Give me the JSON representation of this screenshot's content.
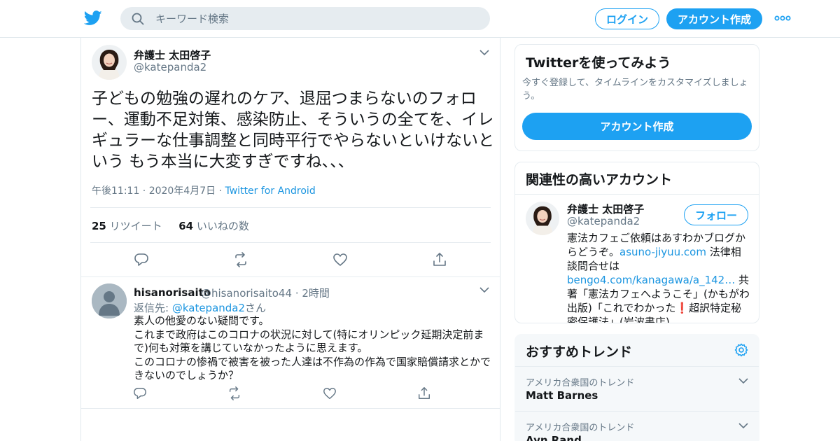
{
  "header": {
    "search_placeholder": "キーワード検索",
    "login_label": "ログイン",
    "signup_label": "アカウント作成",
    "brand_color": "#1da1f2"
  },
  "tweet": {
    "author_name": "弁護士 太田啓子",
    "author_handle": "@katepanda2",
    "text": "子どもの勉強の遅れのケア、退屈つまらないのフォロー、運動不足対策、感染防止、そういうの全てを、イレギュラーな仕事調整と同時平行でやらないといけないという もう本当に大変すぎですね、、、",
    "time": "午後11:11 · 2020年4月7日 · ",
    "source": "Twitter for Android",
    "retweet_count": "25",
    "retweet_label": "リツイート",
    "like_count": "64",
    "like_label": "いいねの数"
  },
  "reply": {
    "author_name": "hisanorisaito",
    "author_handle": "@hisanorisaito44",
    "time": "· 2時間",
    "reply_prefix": "返信先: ",
    "reply_to": "@katepanda2",
    "reply_suffix": "さん",
    "lines": [
      "素人の他愛のない疑問です。",
      "これまで政府はこのコロナの状況に対して(特にオリンピック延期決定前まで)何も対策を講じていなかったように思えます。",
      "このコロナの惨禍で被害を被った人達は不作為の作為で国家賠償請求とかできないのでしょうか？"
    ]
  },
  "try_card": {
    "title": "Twitterを使ってみよう",
    "desc": "今すぐ登録して、タイムラインをカスタマイズしましょう。",
    "button": "アカウント作成"
  },
  "related_card": {
    "title": "関連性の高いアカウント",
    "name": "弁護士 太田啓子",
    "handle": "@katepanda2",
    "follow": "フォロー",
    "bio_1": "憲法カフェご依頼はあすわかブログからどうぞ。",
    "bio_link_1": "asuno-jiyuu.com",
    "bio_2": " 法律相談問合せは",
    "bio_link_2": "bengo4.com/kanagawa/a_142…",
    "bio_3": " 共著「憲法カフェへようこそ」(かもがわ出版)「これでわかった",
    "bio_emoji": "❗",
    "bio_4": "超訳特定秘密保護法」(岩波書店)。"
  },
  "trends_card": {
    "title": "おすすめトレンド",
    "items": [
      {
        "location": "アメリカ合衆国のトレンド",
        "name": "Matt Barnes"
      },
      {
        "location": "アメリカ合衆国のトレンド",
        "name": "Ayn Rand"
      }
    ]
  }
}
